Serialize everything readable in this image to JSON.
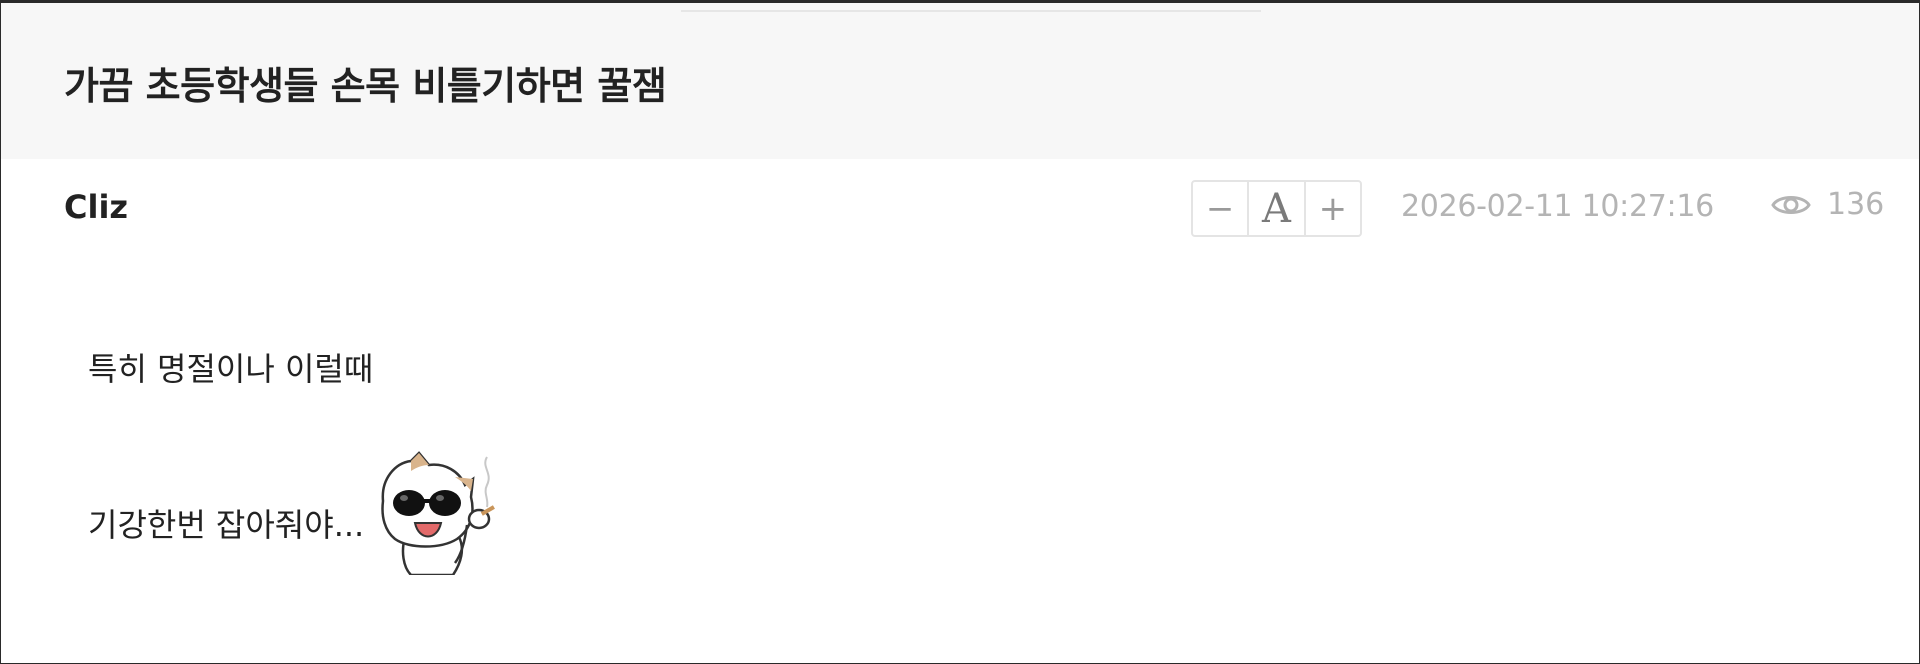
{
  "post": {
    "title": "가끔 초등학생들 손목 비틀기하면 꿀잼",
    "author": "Cliz",
    "datetime": "2026-02-11 10:27:16",
    "views": "136"
  },
  "font_control": {
    "decrease_label": "−",
    "font_label": "A",
    "increase_label": "+"
  },
  "body": {
    "line1": "특히 명절이나 이럴때",
    "line2": "기강한번 잡아줘야..."
  },
  "icons": {
    "views": "eye-icon",
    "sticker": "cat-sunglasses-sticker"
  },
  "colors": {
    "title_bar_bg": "#f7f7f7",
    "meta_text": "#b4b4b4",
    "text": "#222222"
  }
}
